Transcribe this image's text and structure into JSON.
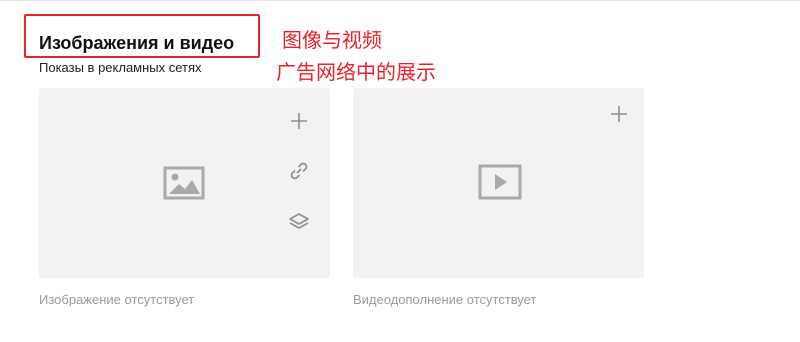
{
  "section": {
    "title": "Изображения и видео",
    "subtitle": "Показы в рекламных сетях"
  },
  "annotation": {
    "color": "#e8232a",
    "line1": "图像与视频",
    "line2": "广告网络中的展示"
  },
  "cards": {
    "image": {
      "placeholder_icon": "image-icon",
      "actions": [
        "plus-icon",
        "link-icon",
        "layers-icon"
      ],
      "caption": "Изображение отсутствует"
    },
    "video": {
      "placeholder_icon": "video-icon",
      "actions": [
        "plus-icon"
      ],
      "caption": "Видеодополнение отсутствует"
    }
  },
  "colors": {
    "card_bg": "#f2f2f2",
    "icon": "#a9a9a9",
    "caption": "#9a9a9a"
  }
}
